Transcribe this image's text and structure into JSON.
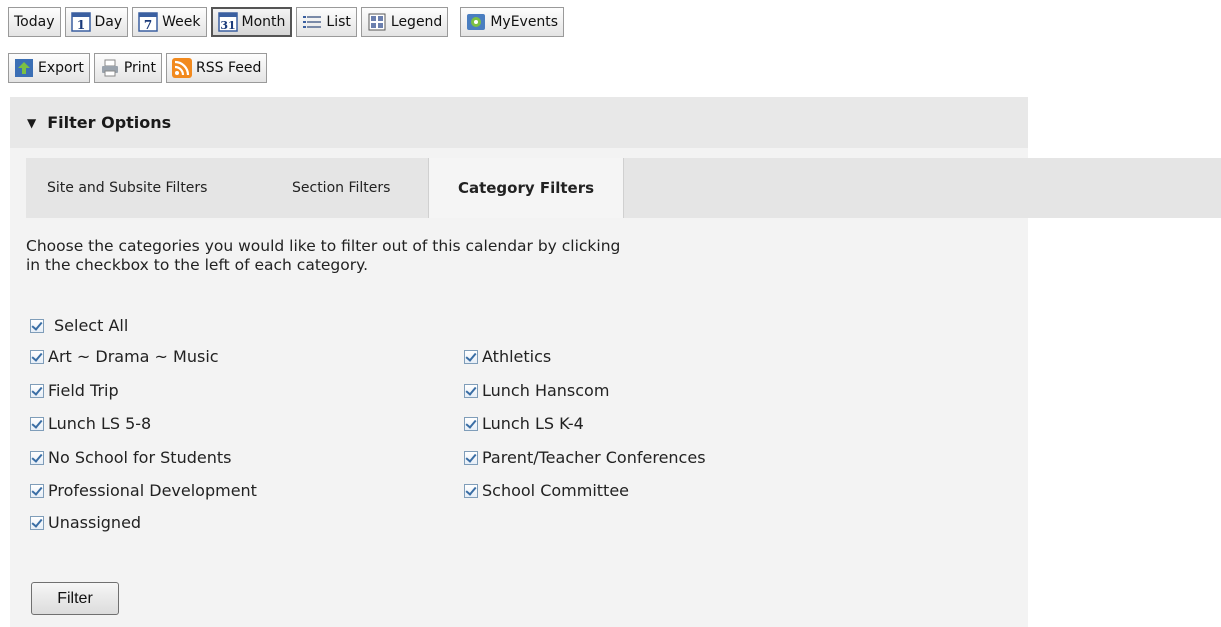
{
  "toolbar": {
    "today": "Today",
    "day": "Day",
    "day_icon_num": "1",
    "week": "Week",
    "week_icon_num": "7",
    "month": "Month",
    "month_icon_num": "31",
    "list": "List",
    "legend": "Legend",
    "myevents": "MyEvents",
    "export": "Export",
    "print": "Print",
    "rss": "RSS Feed"
  },
  "filter": {
    "header": "Filter Options",
    "tabs": [
      "Site and Subsite Filters",
      "Section Filters",
      "Category Filters"
    ],
    "instructions_line1": "Choose the categories you would like to filter out of this calendar by clicking",
    "instructions_line2": "in the checkbox to the left of each category.",
    "select_all": "Select All",
    "left_categories": [
      "Art ~ Drama ~ Music",
      "Field Trip",
      "Lunch LS 5-8",
      "No School for Students",
      "Professional Development",
      "Unassigned"
    ],
    "right_categories": [
      "Athletics",
      "Lunch Hanscom",
      "Lunch LS K-4",
      "Parent/Teacher Conferences",
      "School Committee"
    ],
    "button": "Filter"
  },
  "colors": {
    "rss_orange": "#f28a1e",
    "calendar_blue": "#3a5fa0",
    "header_bg": "#e8e8e8",
    "panel_bg": "#f3f3f3"
  }
}
